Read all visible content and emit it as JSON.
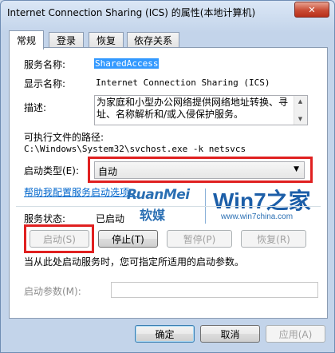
{
  "window": {
    "title": "Internet Connection Sharing (ICS) 的属性(本地计算机)",
    "close_label": "✕"
  },
  "tabs": [
    {
      "label": "常规"
    },
    {
      "label": "登录"
    },
    {
      "label": "恢复"
    },
    {
      "label": "依存关系"
    }
  ],
  "general": {
    "service_name_label": "服务名称:",
    "service_name_value": "SharedAccess",
    "display_name_label": "显示名称:",
    "display_name_value": "Internet Connection Sharing (ICS)",
    "description_label": "描述:",
    "description_value": "为家庭和小型办公网络提供网络地址转换、寻址、名称解析和/或入侵保护服务。",
    "exe_path_label": "可执行文件的路径:",
    "exe_path_value": "C:\\Windows\\System32\\svchost.exe -k netsvcs",
    "startup_type_label": "启动类型(E):",
    "startup_type_value": "自动",
    "help_link": "帮助我配置服务启动选项。",
    "status_label": "服务状态:",
    "status_value": "已启动",
    "buttons": {
      "start": "启动(S)",
      "stop": "停止(T)",
      "pause": "暂停(P)",
      "resume": "恢复(R)"
    },
    "start_params_hint": "当从此处启动服务时，您可指定所适用的启动参数。",
    "start_params_label": "启动参数(M):",
    "start_params_value": ""
  },
  "watermark": {
    "brand_latin": "RuanMei",
    "brand_cn": "软媒",
    "logo": "Win7之家",
    "url": "www.win7china.com"
  },
  "footer": {
    "ok": "确定",
    "cancel": "取消",
    "apply": "应用(A)"
  },
  "colors": {
    "highlight_border": "#e02020",
    "link": "#0066cc",
    "selection": "#3399ff"
  },
  "icons": {
    "dropdown": "chevron-down-icon",
    "close": "close-icon"
  }
}
